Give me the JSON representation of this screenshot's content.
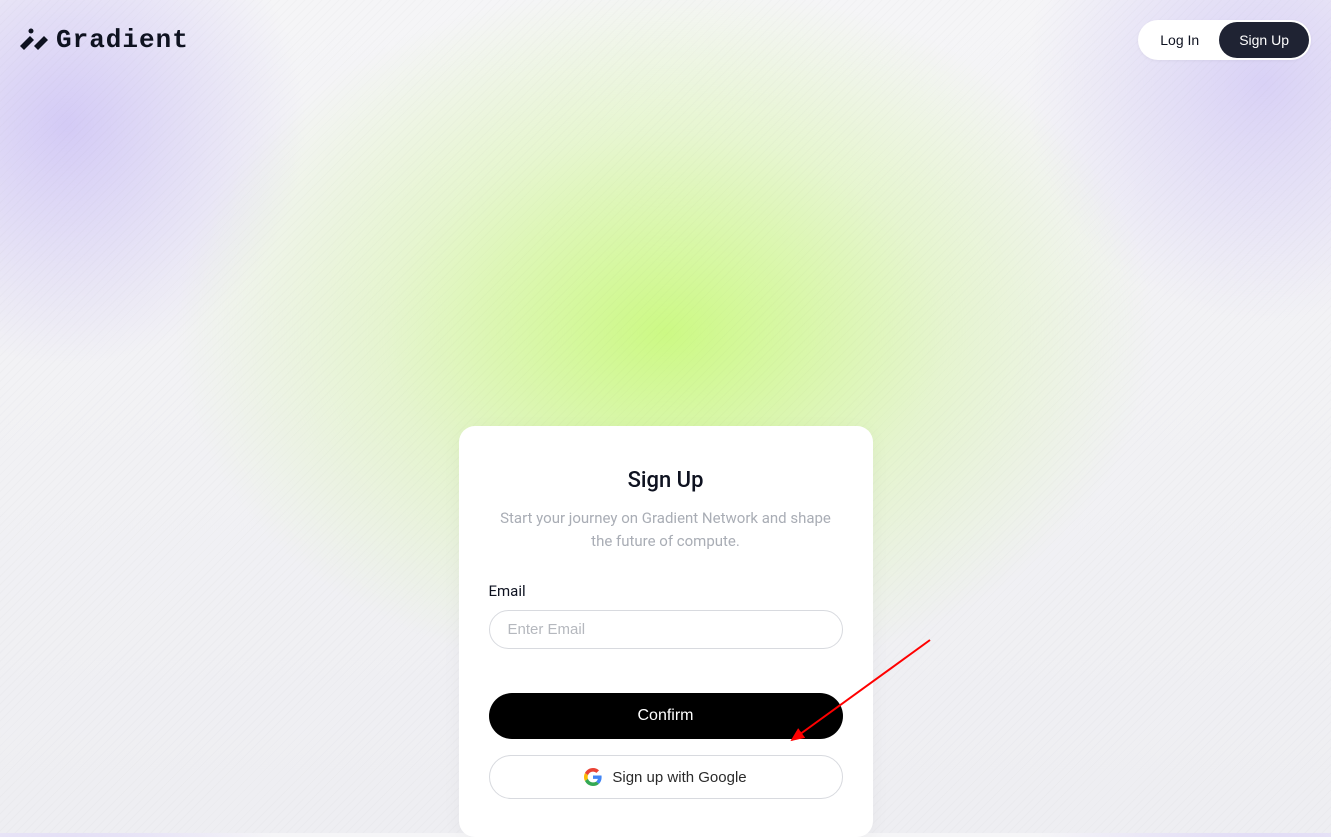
{
  "header": {
    "brand": "Gradient",
    "login_label": "Log In",
    "signup_label": "Sign Up"
  },
  "card": {
    "title": "Sign Up",
    "subtitle": "Start your journey on Gradient Network and shape the future of compute.",
    "email_label": "Email",
    "email_placeholder": "Enter Email",
    "confirm_label": "Confirm",
    "google_label": "Sign up with Google"
  }
}
